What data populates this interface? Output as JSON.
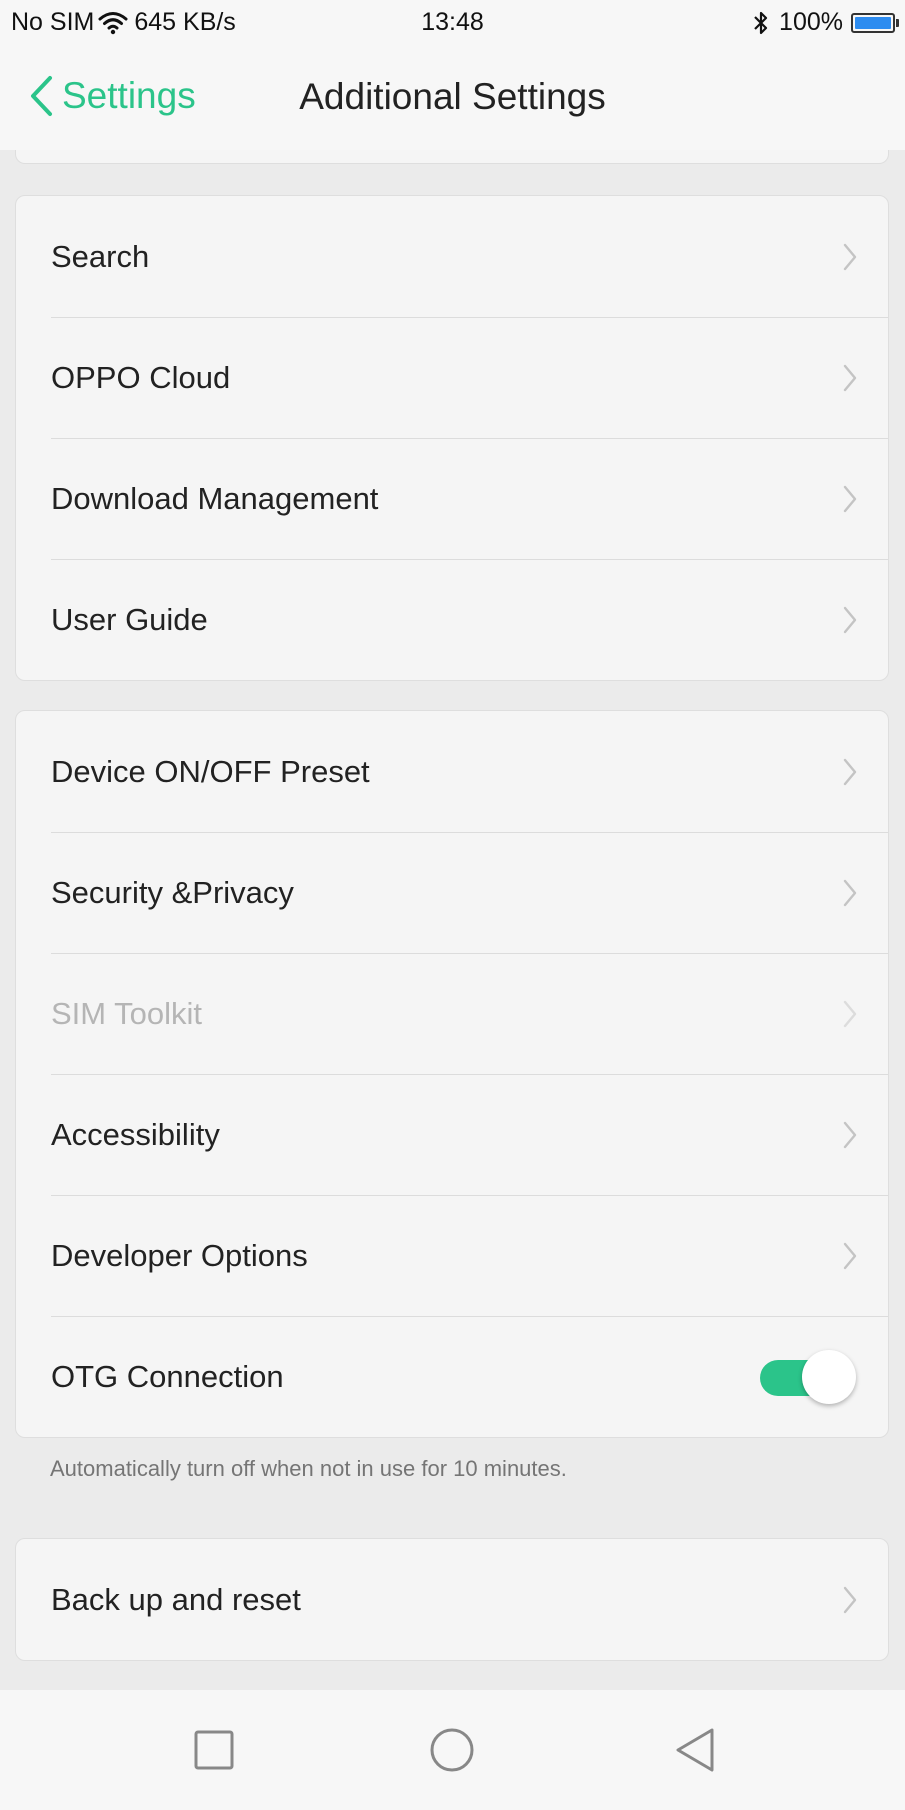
{
  "status_bar": {
    "carrier": "No SIM",
    "speed": "645 KB/s",
    "time": "13:48",
    "battery": "100%",
    "battery_level": 1.0,
    "battery_color": "#2d8cf0",
    "icons": [
      "wifi-icon",
      "bluetooth-icon",
      "battery-icon"
    ]
  },
  "header": {
    "back_label": "Settings",
    "title": "Additional Settings",
    "accent_color": "#2bc48a"
  },
  "group1": {
    "items": [
      {
        "label": "Search"
      },
      {
        "label": "OPPO Cloud"
      },
      {
        "label": "Download Management"
      },
      {
        "label": "User Guide"
      }
    ]
  },
  "group2": {
    "items": [
      {
        "label": "Device ON/OFF Preset"
      },
      {
        "label": "Security &Privacy"
      },
      {
        "label": "SIM Toolkit",
        "enabled": false
      },
      {
        "label": "Accessibility"
      },
      {
        "label": "Developer Options"
      },
      {
        "label": "OTG Connection",
        "toggle": true,
        "toggle_on": true
      }
    ],
    "note": "Automatically turn off when not in use for 10 minutes."
  },
  "group3": {
    "items": [
      {
        "label": "Back up and reset"
      }
    ]
  },
  "nav_bar": {
    "buttons": [
      "recent-apps-icon",
      "home-icon",
      "back-triangle-icon"
    ]
  }
}
